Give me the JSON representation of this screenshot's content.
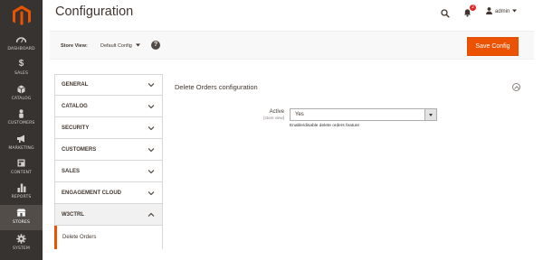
{
  "nav": {
    "items": [
      {
        "label": "DASHBOARD",
        "icon": "dashboard-icon"
      },
      {
        "label": "SALES",
        "icon": "dollar-icon"
      },
      {
        "label": "CATALOG",
        "icon": "cube-icon"
      },
      {
        "label": "CUSTOMERS",
        "icon": "person-icon"
      },
      {
        "label": "MARKETING",
        "icon": "megaphone-icon"
      },
      {
        "label": "CONTENT",
        "icon": "layout-icon"
      },
      {
        "label": "REPORTS",
        "icon": "bar-chart-icon"
      },
      {
        "label": "STORES",
        "icon": "store-icon"
      },
      {
        "label": "SYSTEM",
        "icon": "gear-icon"
      }
    ],
    "active": "STORES"
  },
  "header": {
    "title": "Configuration",
    "notifications_count": "2",
    "user": "admin"
  },
  "store_view": {
    "label": "Store View:",
    "value": "Default Config",
    "help": "?"
  },
  "toolbar": {
    "save_label": "Save Config"
  },
  "tabs": [
    {
      "label": "GENERAL"
    },
    {
      "label": "CATALOG"
    },
    {
      "label": "SECURITY"
    },
    {
      "label": "CUSTOMERS"
    },
    {
      "label": "SALES"
    },
    {
      "label": "ENGAGEMENT CLOUD"
    },
    {
      "label": "W3CTRL"
    }
  ],
  "subtab": {
    "label": "Delete Orders"
  },
  "section": {
    "title": "Delete Orders configuration",
    "field": {
      "label": "Active",
      "scope": "[store view]",
      "value": "Yes",
      "note": "Enable/disable delete orders feature"
    }
  },
  "colors": {
    "accent": "#eb5202",
    "nav_bg": "#373330"
  }
}
